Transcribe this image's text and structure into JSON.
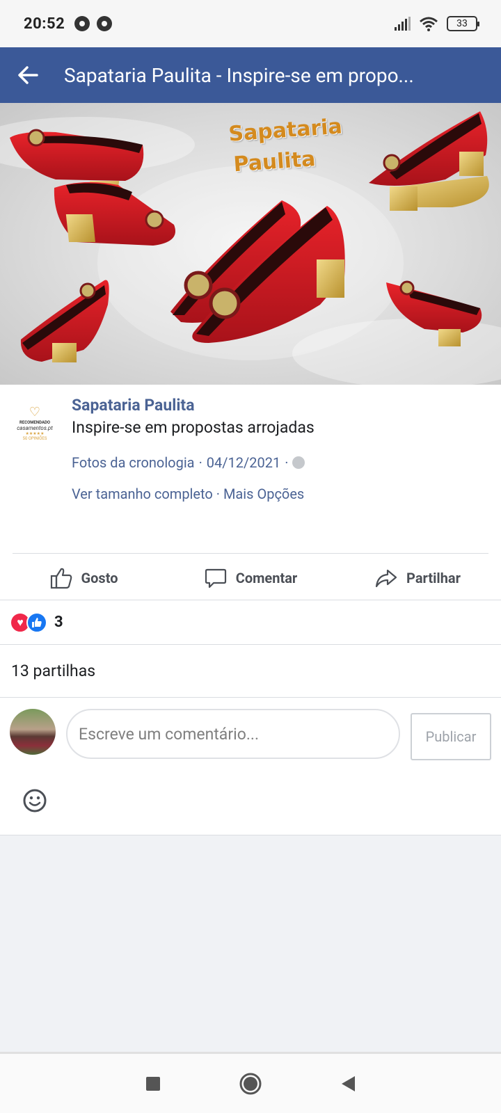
{
  "status_bar": {
    "time": "20:52",
    "battery": "33"
  },
  "app_bar": {
    "title": "Sapataria Paulita - Inspire-se em propo..."
  },
  "photo": {
    "brand_line1": "Sapataria",
    "brand_line2": "Paulita"
  },
  "post": {
    "author": "Sapataria Paulita",
    "caption": "Inspire-se em propostas arrojadas",
    "album": "Fotos da cronologia",
    "date": "04/12/2021",
    "sep": "·",
    "full_size": "Ver tamanho completo",
    "more_options": "Mais Opções",
    "logo_line1": "RECOMENDADO",
    "logo_line2": "casamentos.pt",
    "logo_line3": "50 OPINIÕES"
  },
  "actions": {
    "like": "Gosto",
    "comment": "Comentar",
    "share": "Partilhar"
  },
  "reactions": {
    "count": "3"
  },
  "shares": {
    "text": "13 partilhas"
  },
  "comment": {
    "placeholder": "Escreve um comentário...",
    "publish": "Publicar"
  },
  "colors": {
    "app_bar": "#3b5998",
    "link": "#4b6394",
    "heart": "#f0284a",
    "like": "#1877f2"
  }
}
